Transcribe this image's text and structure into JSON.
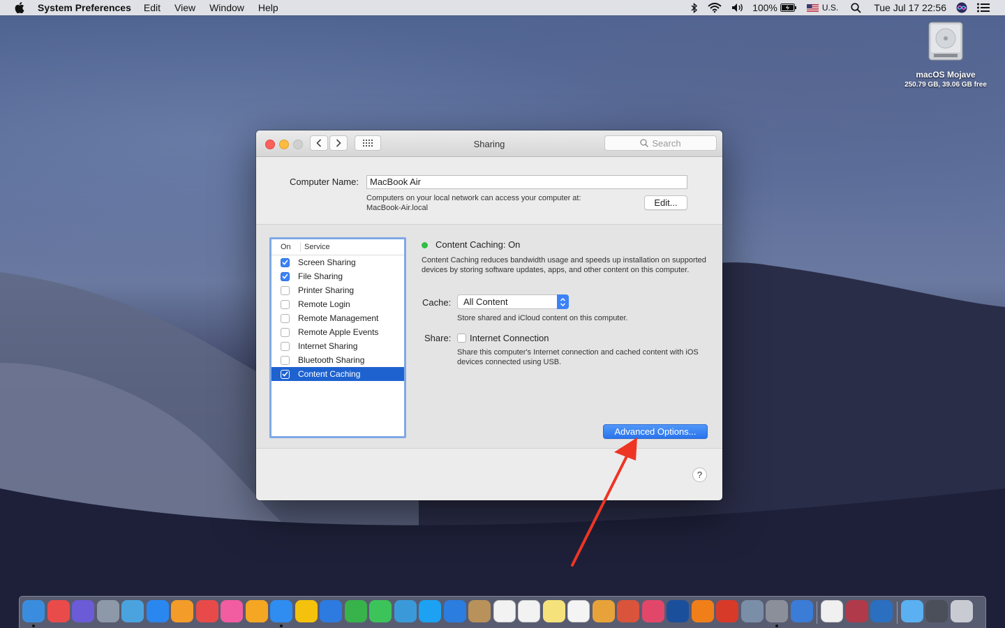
{
  "menubar": {
    "app_name": "System Preferences",
    "menus": [
      "Edit",
      "View",
      "Window",
      "Help"
    ],
    "battery": "100%",
    "input_source": "U.S.",
    "clock": "Tue Jul 17  22:56"
  },
  "desktop": {
    "drive_name": "macOS Mojave",
    "drive_info": "250.79 GB, 39.06 GB free"
  },
  "window": {
    "title": "Sharing",
    "search_placeholder": "Search",
    "computer_name_label": "Computer Name:",
    "computer_name_value": "MacBook Air",
    "computer_name_desc_line1": "Computers on your local network can access your computer at:",
    "computer_name_desc_line2": "MacBook-Air.local",
    "edit_button": "Edit...",
    "list_headers": {
      "on": "On",
      "service": "Service"
    },
    "services": [
      {
        "label": "Screen Sharing",
        "checked": true,
        "selected": false
      },
      {
        "label": "File Sharing",
        "checked": true,
        "selected": false
      },
      {
        "label": "Printer Sharing",
        "checked": false,
        "selected": false
      },
      {
        "label": "Remote Login",
        "checked": false,
        "selected": false
      },
      {
        "label": "Remote Management",
        "checked": false,
        "selected": false
      },
      {
        "label": "Remote Apple Events",
        "checked": false,
        "selected": false
      },
      {
        "label": "Internet Sharing",
        "checked": false,
        "selected": false
      },
      {
        "label": "Bluetooth Sharing",
        "checked": false,
        "selected": false
      },
      {
        "label": "Content Caching",
        "checked": true,
        "selected": true
      }
    ],
    "status_text": "Content Caching: On",
    "status_color": "#2fc043",
    "description": "Content Caching reduces bandwidth usage and speeds up installation on supported devices by storing software updates, apps, and other content on this computer.",
    "cache_label": "Cache:",
    "cache_value": "All Content",
    "cache_note": "Store shared and iCloud content on this computer.",
    "share_label": "Share:",
    "share_option": "Internet Connection",
    "share_note": "Share this computer's Internet connection and cached content with iOS devices connected using USB.",
    "advanced_button": "Advanced Options...",
    "help_button": "?"
  },
  "dock": {
    "icons": [
      "finder-icon",
      "photo-booth-icon",
      "siri-icon",
      "launchpad-icon",
      "preview-icon",
      "app-store-icon",
      "books-icon",
      "news-icon",
      "itunes-icon",
      "photos-icon",
      "safari-icon",
      "chrome-icon",
      "skype-icon",
      "messages-icon",
      "facetime-icon",
      "tweetbot-icon",
      "twitter-icon",
      "testflight-icon",
      "notebook-icon",
      "calendar-icon",
      "calendar-2-icon",
      "notes-icon",
      "reminders-icon",
      "image-editor-icon",
      "pixelmator-icon",
      "airmail-icon",
      "1password-icon",
      "vlc-icon",
      "pdf-icon",
      "system-info-icon",
      "system-preferences-icon",
      "nordvpn-icon",
      "textedit-icon",
      "photo-collage-icon",
      "quicktime-icon",
      "downloads-folder-icon",
      "screenshot-icon",
      "trash-icon"
    ]
  }
}
